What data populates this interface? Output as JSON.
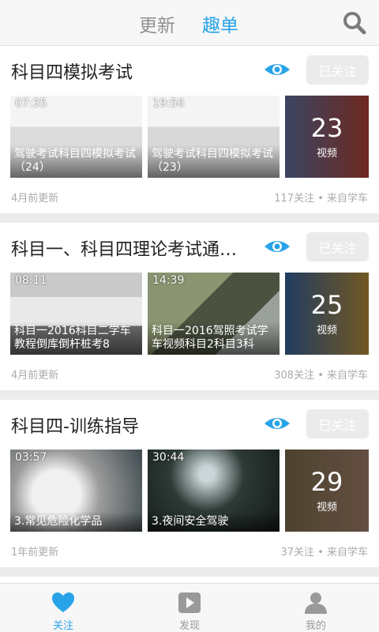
{
  "header": {
    "tabs": [
      {
        "label": "更新"
      },
      {
        "label": "趣单"
      }
    ]
  },
  "cards": [
    {
      "title": "科目四模拟考试",
      "follow_label": "已关注",
      "videos": [
        {
          "duration": "07:35",
          "caption": "驾驶考试科目四模拟考试（24）"
        },
        {
          "duration": "19:56",
          "caption": "驾驶考试科目四模拟考试（23）"
        }
      ],
      "count": "23",
      "count_unit": "视频",
      "updated": "4月前更新",
      "stats": "117关注 • 来自学车"
    },
    {
      "title": "科目一、科目四理论考试通…",
      "follow_label": "已关注",
      "videos": [
        {
          "duration": "08:11",
          "caption": "科目一2016科目二学车教程倒库倒杆桩考8"
        },
        {
          "duration": "14:39",
          "caption": "科目一2016驾照考试学车视频科目2科目3科"
        }
      ],
      "count": "25",
      "count_unit": "视频",
      "updated": "4月前更新",
      "stats": "308关注 • 来自学车"
    },
    {
      "title": "科目四-训练指导",
      "follow_label": "已关注",
      "videos": [
        {
          "duration": "03:57",
          "caption": "3.常见危险化学品"
        },
        {
          "duration": "30:44",
          "caption": "3.夜间安全驾驶"
        }
      ],
      "count": "29",
      "count_unit": "视频",
      "updated": "1年前更新",
      "stats": "37关注 • 来自学车"
    }
  ],
  "nav": [
    {
      "label": "关注"
    },
    {
      "label": "发现"
    },
    {
      "label": "我的"
    }
  ],
  "colors": {
    "accent": "#29a3e8"
  }
}
